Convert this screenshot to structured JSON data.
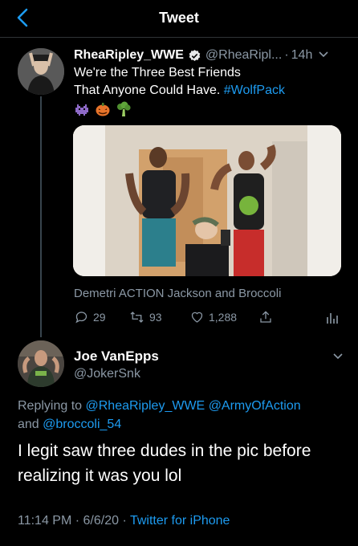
{
  "header": {
    "title": "Tweet"
  },
  "tweet": {
    "author_name": "RheaRipley_WWE",
    "author_handle": "@RheaRipl...",
    "separator": "·",
    "time": "14h",
    "text_line1": "We're the Three Best Friends",
    "text_line2_plain": "That Anyone Could Have. ",
    "hashtag": "#WolfPack",
    "emojis": [
      "alien-monster",
      "jack-o-lantern",
      "broccoli"
    ],
    "media_caption": "Demetri ACTION Jackson and Broccoli",
    "actions": {
      "replies": "29",
      "retweets": "93",
      "likes": "1,288"
    }
  },
  "reply": {
    "author_name": "Joe VanEpps",
    "author_handle": "@JokerSnk",
    "replying_prefix": "Replying to ",
    "mention1": "@RheaRipley_WWE",
    "mention2": "@ArmyOfAction",
    "and_text": "and ",
    "mention3": "@broccoli_54",
    "text": "I legit saw three dudes in the pic before realizing it was you lol",
    "time": "11:14 PM",
    "date": "6/6/20",
    "separator": "·",
    "source": "Twitter for iPhone"
  },
  "colors": {
    "accent": "#1d9bf0",
    "background": "#000000",
    "muted": "#8b98a5"
  }
}
